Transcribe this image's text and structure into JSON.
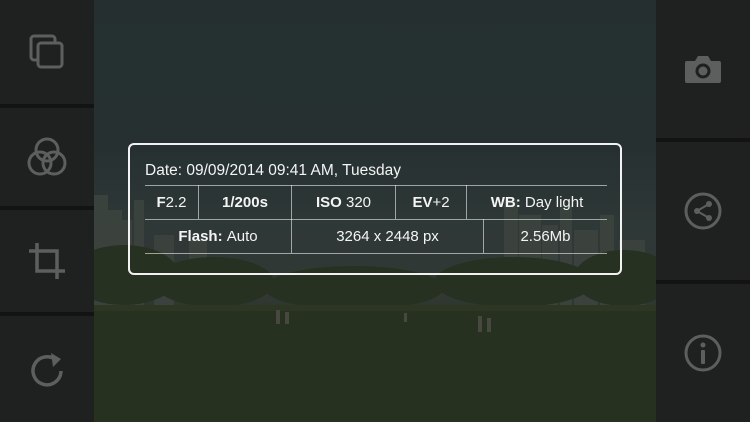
{
  "photo_info": {
    "date_label": "Date:",
    "date_value": "09/09/2014 09:41 AM, Tuesday",
    "aperture_prefix": "F",
    "aperture_value": "2.2",
    "shutter": "1/200s",
    "iso_label": "ISO",
    "iso_value": "320",
    "ev_label": "EV",
    "ev_value": "+2",
    "wb_label": "WB:",
    "wb_value": "Day light",
    "flash_label": "Flash:",
    "flash_value": "Auto",
    "resolution": "3264 x 2448 px",
    "file_size": "2.56Mb"
  },
  "left_toolbar": [
    {
      "icon": "copy-icon"
    },
    {
      "icon": "color-filter-icon"
    },
    {
      "icon": "crop-icon"
    },
    {
      "icon": "rotate-icon"
    }
  ],
  "right_toolbar": [
    {
      "icon": "camera-icon"
    },
    {
      "icon": "share-icon"
    },
    {
      "icon": "info-icon"
    }
  ],
  "colors": {
    "toolbar_bg": "#1f2120",
    "icon": "#5d5f5e",
    "panel_border": "#f2f2f2"
  }
}
